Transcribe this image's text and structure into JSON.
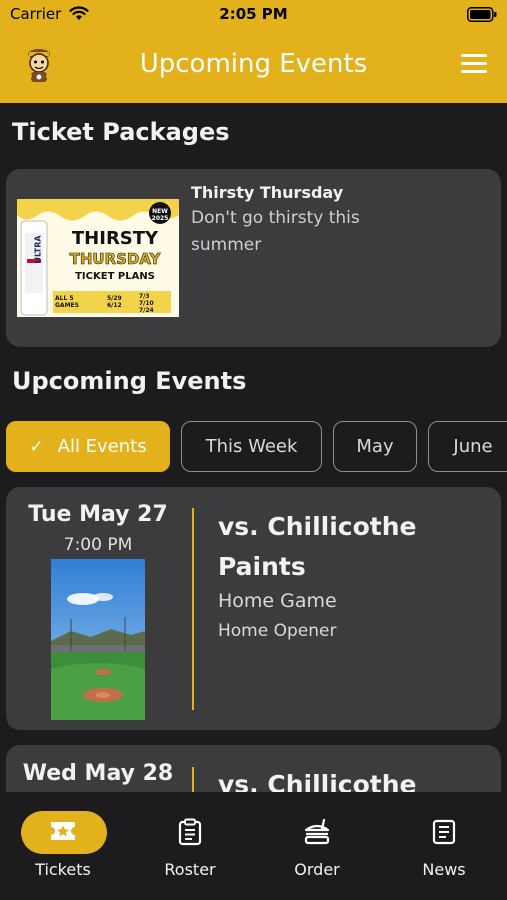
{
  "status_bar": {
    "carrier": "Carrier",
    "time": "2:05 PM"
  },
  "header": {
    "title": "Upcoming Events"
  },
  "ticket_packages": {
    "section_title": "Ticket Packages",
    "items": [
      {
        "title": "Thirsty Thursday",
        "description": "Don't go thirsty this summer",
        "image": {
          "badge": "NEW 2025",
          "brand": "ULTRA",
          "line1": "THIRSTY",
          "line2": "THURSDAY",
          "line3": "TICKET PLANS",
          "footer_left": "ALL 5 GAMES",
          "dates_a": "5/29 6/12",
          "dates_b": "7/3 7/10 7/24"
        }
      }
    ]
  },
  "upcoming_events": {
    "section_title": "Upcoming Events",
    "filters": [
      {
        "label": "All Events",
        "selected": true
      },
      {
        "label": "This Week",
        "selected": false
      },
      {
        "label": "May",
        "selected": false
      },
      {
        "label": "June",
        "selected": false
      }
    ],
    "events": [
      {
        "date": "Tue May 27",
        "time": "7:00 PM",
        "opponent": "vs. Chillicothe Paints",
        "type": "Home Game",
        "note": "Home Opener"
      },
      {
        "date": "Wed May 28",
        "opponent": "vs. Chillicothe"
      }
    ]
  },
  "tab_bar": {
    "tabs": [
      {
        "label": "Tickets",
        "icon": "ticket-star-icon",
        "active": true
      },
      {
        "label": "Roster",
        "icon": "clipboard-icon",
        "active": false
      },
      {
        "label": "Order",
        "icon": "food-order-icon",
        "active": false
      },
      {
        "label": "News",
        "icon": "news-icon",
        "active": false
      }
    ]
  },
  "colors": {
    "accent": "#e3b11c",
    "background": "#1c1c1e",
    "card": "#3c3c3e"
  }
}
